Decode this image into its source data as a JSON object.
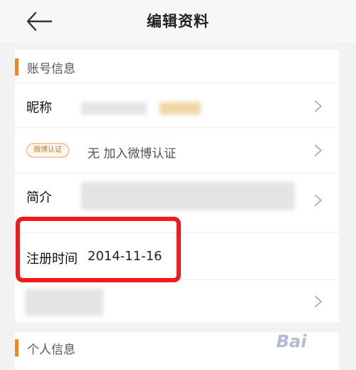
{
  "header": {
    "title": "编辑资料"
  },
  "account_section": {
    "title": "账号信息",
    "nickname_label": "昵称",
    "weibo_badge": "微博认证",
    "weibo_value": "无 加入微博认证",
    "intro_label": "简介",
    "reg_label": "注册时间",
    "reg_date": "2014-11-16"
  },
  "personal_section": {
    "title": "个人信息"
  },
  "watermark": "Bai"
}
